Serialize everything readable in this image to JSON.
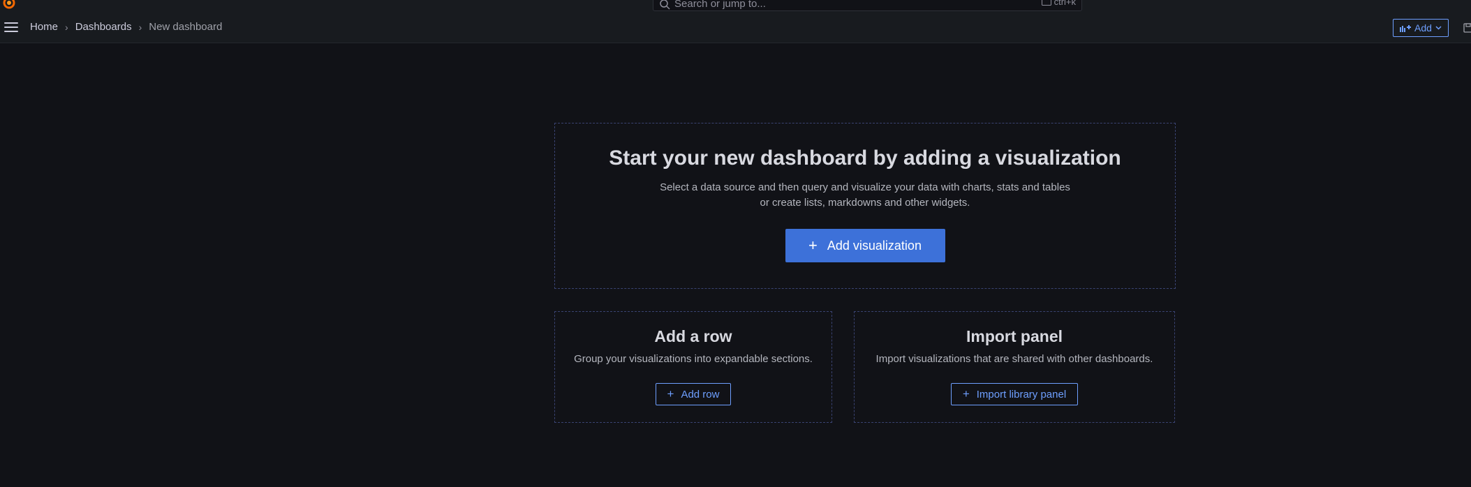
{
  "search": {
    "placeholder": "Search or jump to...",
    "shortcut": "ctrl+k"
  },
  "breadcrumb": {
    "home": "Home",
    "dashboards": "Dashboards",
    "current": "New dashboard",
    "separator": "›"
  },
  "toolbar": {
    "add_label": "Add"
  },
  "empty_state": {
    "title": "Start your new dashboard by adding a visualization",
    "desc_line1": "Select a data source and then query and visualize your data with charts, stats and tables",
    "desc_line2": "or create lists, markdowns and other widgets.",
    "button_label": "Add visualization",
    "button_icon": "+"
  },
  "add_row": {
    "title": "Add a row",
    "desc": "Group your visualizations into expandable sections.",
    "button_label": "Add row",
    "button_icon": "+"
  },
  "import_panel": {
    "title": "Import panel",
    "desc": "Import visualizations that are shared with other dashboards.",
    "button_label": "Import library panel",
    "button_icon": "+"
  },
  "colors": {
    "background": "#111217",
    "accent": "#3d71d9",
    "link": "#6e9fff",
    "logo": "#f46800"
  }
}
